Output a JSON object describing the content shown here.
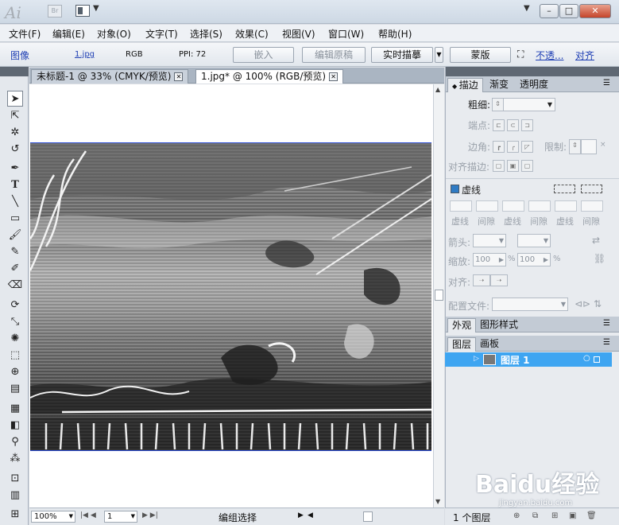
{
  "app": {
    "logo": "Ai",
    "bridge_label": "Br"
  },
  "window": {
    "minimize": "–",
    "maximize": "□",
    "close": "✕",
    "workspace_arrow": "▼"
  },
  "menu": [
    "文件(F)",
    "编辑(E)",
    "对象(O)",
    "文字(T)",
    "选择(S)",
    "效果(C)",
    "视图(V)",
    "窗口(W)",
    "帮助(H)"
  ],
  "control": {
    "object_type": "图像",
    "file_link": "1.jpg",
    "color_mode": "RGB",
    "ppi": "PPI: 72",
    "embed": "嵌入",
    "edit_original": "编辑原稿",
    "live_trace": "实时描摹",
    "mask": "蒙版",
    "opacity_link": "不透...",
    "align_link": "对齐"
  },
  "doc_tabs": [
    {
      "label": "未标题-1 @ 33% (CMYK/预览)",
      "active": false
    },
    {
      "label": "1.jpg* @ 100% (RGB/预览)",
      "active": true
    }
  ],
  "status": {
    "zoom": "100%",
    "page": "1",
    "mode": "编组选择"
  },
  "stroke_panel": {
    "tabs": [
      "描边",
      "渐变",
      "透明度"
    ],
    "weight": "粗细:",
    "cap": "端点:",
    "corner": "边角:",
    "limit": "限制:",
    "align_stroke": "对齐描边:",
    "dashed": "虚线",
    "dash_labels": [
      "虚线",
      "间隙",
      "虚线",
      "间隙",
      "虚线",
      "间隙"
    ],
    "arrowheads": "箭头:",
    "scale": "缩放:",
    "scale_value_1": "100",
    "scale_value_2": "100",
    "percent": "%",
    "align": "对齐:",
    "profile": "配置文件:"
  },
  "appearance_tabs": [
    "外观",
    "图形样式"
  ],
  "layers_tabs": [
    "图层",
    "画板"
  ],
  "layers": [
    {
      "name": "图层 1",
      "visible": true
    }
  ],
  "layers_count": "1 个图层",
  "watermark": {
    "main": "Baidu经验",
    "sub": "jingyan.baidu.com"
  },
  "colors": {
    "accent": "#3ea5f1",
    "link": "#1f3fb4",
    "selection_border": "#2a4bd4"
  }
}
